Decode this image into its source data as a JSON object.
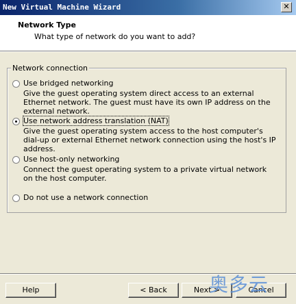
{
  "window": {
    "title": "New Virtual Machine Wizard"
  },
  "header": {
    "title": "Network Type",
    "subtitle": "What type of network do you want to add?"
  },
  "group": {
    "label": "Network connection"
  },
  "options": [
    {
      "label": "Use bridged networking",
      "description": "Give the guest operating system direct access to an external Ethernet network. The guest must have its own IP address on the external network.",
      "selected": false
    },
    {
      "label": "Use network address translation (NAT)",
      "description": "Give the guest operating system access to the host computer's dial-up or external Ethernet network connection using the host's IP address.",
      "selected": true
    },
    {
      "label": "Use host-only networking",
      "description": "Connect the guest operating system to a private virtual network on the host computer.",
      "selected": false
    },
    {
      "label": "Do not use a network connection",
      "description": "",
      "selected": false
    }
  ],
  "buttons": {
    "help": "Help",
    "back": "< Back",
    "next": "Next >",
    "cancel": "Cancel"
  },
  "watermark": {
    "text": "奥多云"
  },
  "icons": {
    "close": "close-icon"
  }
}
